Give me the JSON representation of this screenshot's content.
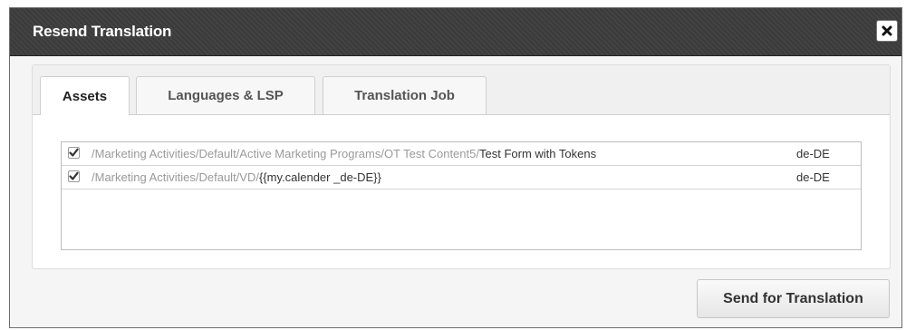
{
  "dialog": {
    "title": "Resend Translation",
    "close_icon": "close-icon"
  },
  "tabs": [
    {
      "label": "Assets",
      "active": true
    },
    {
      "label": "Languages & LSP",
      "active": false
    },
    {
      "label": "Translation Job",
      "active": false
    }
  ],
  "assets": [
    {
      "checked": true,
      "path": "/Marketing Activities/Default/Active Marketing Programs/OT Test Content5/",
      "name": "Test Form with Tokens",
      "language": "de-DE"
    },
    {
      "checked": true,
      "path": "/Marketing Activities/Default/VD/",
      "name": "{{my.calender _de-DE}}",
      "language": "de-DE"
    }
  ],
  "footer": {
    "send_label": "Send for Translation"
  },
  "colors": {
    "titlebar": "#3b3b3b",
    "muted_path": "#9a9a9a"
  }
}
